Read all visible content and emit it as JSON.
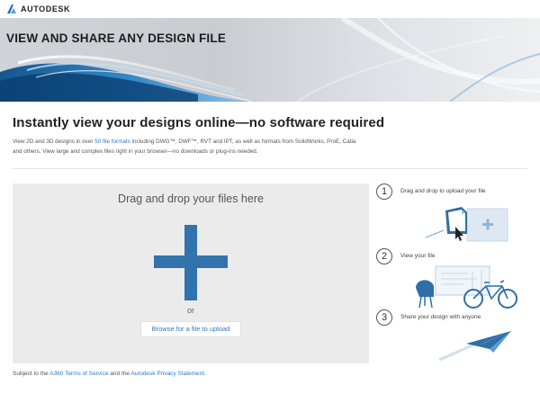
{
  "brand": {
    "name": "AUTODESK",
    "logo_icon": "autodesk-logo-icon"
  },
  "hero": {
    "title": "VIEW AND SHARE ANY DESIGN FILE"
  },
  "intro": {
    "heading": "Instantly view your designs online—no software required",
    "line1_before": "View 2D and 3D designs in over ",
    "line1_link": "50 file formats",
    "line1_after": " including DWG™, DWF™, RVT and IPT, as well as formats from SolidWorks, ProE, Catia",
    "line2": "and others. View large and complex files right in your browser—no downloads or plug-ins needed."
  },
  "dropzone": {
    "title": "Drag and drop your files here",
    "or_text": "or",
    "browse_label": "Browse for a file to upload"
  },
  "terms": {
    "prefix": "Subject to the ",
    "tos_link": "A360 Terms of Service",
    "middle": " and the ",
    "privacy_link": "Autodesk Privacy Statement",
    "suffix": "."
  },
  "steps": [
    {
      "number": "1",
      "label": "Drag and drop to upload your file",
      "icon": "upload-illustration"
    },
    {
      "number": "2",
      "label": "View your file",
      "icon": "view-file-illustration"
    },
    {
      "number": "3",
      "label": "Share your design with anyone",
      "icon": "paper-plane-illustration"
    }
  ],
  "colors": {
    "accent_blue": "#3272ad",
    "link_blue": "#2c7bc2",
    "dropzone_bg": "#ebebeb"
  }
}
